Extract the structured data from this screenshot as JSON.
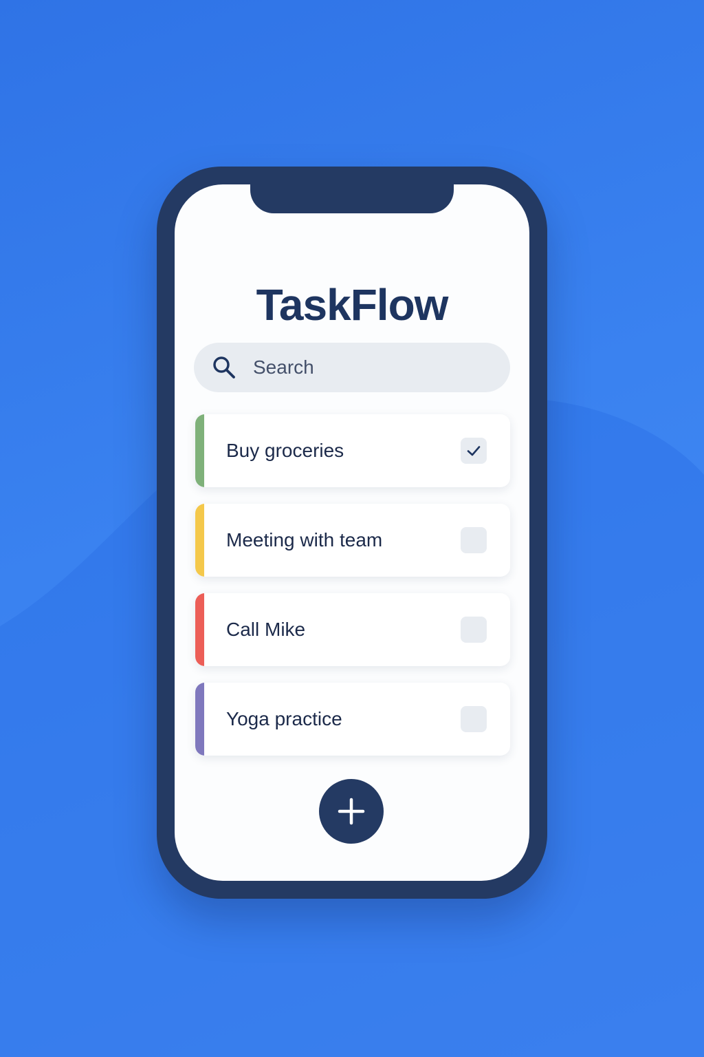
{
  "app": {
    "title": "TaskFlow"
  },
  "search": {
    "placeholder": "Search",
    "icon": "search-icon"
  },
  "tasks": [
    {
      "label": "Buy groceries",
      "color": "#7fb17a",
      "done": true
    },
    {
      "label": "Meeting with team",
      "color": "#f4c84b",
      "done": false
    },
    {
      "label": "Call Mike",
      "color": "#ec5e57",
      "done": false
    },
    {
      "label": "Yoga practice",
      "color": "#7f78bd",
      "done": false
    }
  ],
  "add_button": {
    "icon": "plus-icon"
  },
  "colors": {
    "background": "#3a82f0",
    "phone_frame": "#243a63",
    "screen": "#fcfdfe",
    "title_text": "#1e3560",
    "search_field": "#e8ecf1"
  }
}
